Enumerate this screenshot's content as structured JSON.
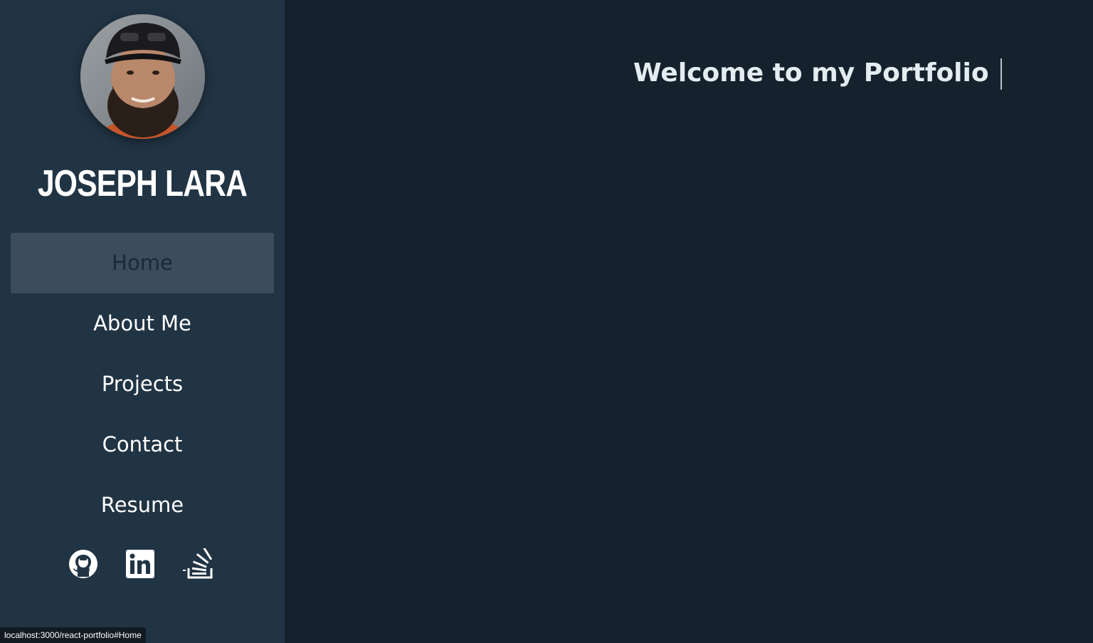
{
  "sidebar": {
    "name": "Joseph Lara",
    "avatar_alt": "profile photo",
    "nav": [
      {
        "label": "Home",
        "active": true
      },
      {
        "label": "About Me",
        "active": false
      },
      {
        "label": "Projects",
        "active": false
      },
      {
        "label": "Contact",
        "active": false
      },
      {
        "label": "Resume",
        "active": false
      }
    ],
    "socials": [
      {
        "icon": "github-icon"
      },
      {
        "icon": "linkedin-icon"
      },
      {
        "icon": "stackoverflow-icon"
      }
    ]
  },
  "main": {
    "welcome_text": "Welcome to my Portfolio"
  },
  "status_bar": {
    "url": "localhost:3000/react-portfolio#Home"
  },
  "colors": {
    "sidebar_bg": "#213444",
    "main_bg": "#15222d",
    "active_nav_bg": "#3c4c5c",
    "text": "#ffffff"
  }
}
